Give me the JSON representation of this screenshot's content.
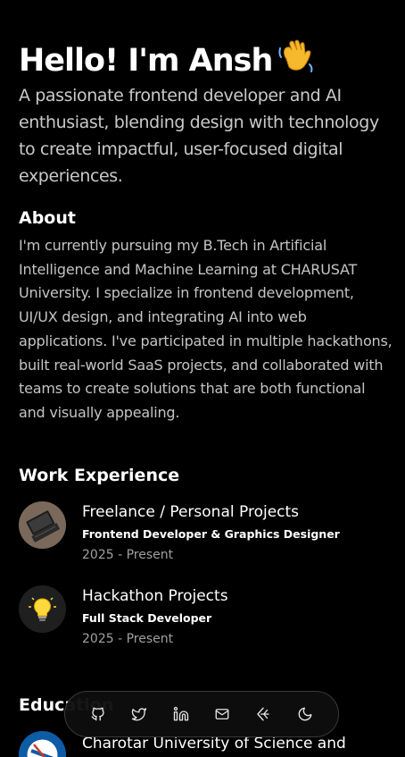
{
  "hero": {
    "title": "Hello! I'm Ansh",
    "subtitle": "A passionate frontend developer and AI enthusiast, blending design with technology to create impactful, user-focused digital experiences."
  },
  "about": {
    "heading": "About",
    "text": "I'm currently pursuing my B.Tech in Artificial Intelligence and Machine Learning at CHARUSAT University. I specialize in frontend development, UI/UX design, and integrating AI into web applications. I've participated in multiple hackathons, built real-world SaaS projects, and collaborated with teams to create solutions that are both functional and visually appealing."
  },
  "work": {
    "heading": "Work Experience",
    "items": [
      {
        "title": "Freelance / Personal Projects",
        "role": "Frontend Developer & Graphics Designer",
        "date": "2025 - Present",
        "icon": "laptop-icon"
      },
      {
        "title": "Hackathon Projects",
        "role": "Full Stack Developer",
        "date": "2025 - Present",
        "icon": "lightbulb-icon"
      }
    ]
  },
  "education": {
    "heading": "Education",
    "items": [
      {
        "title": "Charotar University of Science and",
        "icon": "university-logo"
      }
    ]
  },
  "dock": {
    "items": [
      "github-icon",
      "twitter-icon",
      "linkedin-icon",
      "mail-icon",
      "resume-icon",
      "theme-toggle-icon"
    ]
  },
  "colors": {
    "background": "#000000",
    "text": "#ffffff",
    "muted": "#c4c4c4",
    "date": "#a0a0a0"
  }
}
